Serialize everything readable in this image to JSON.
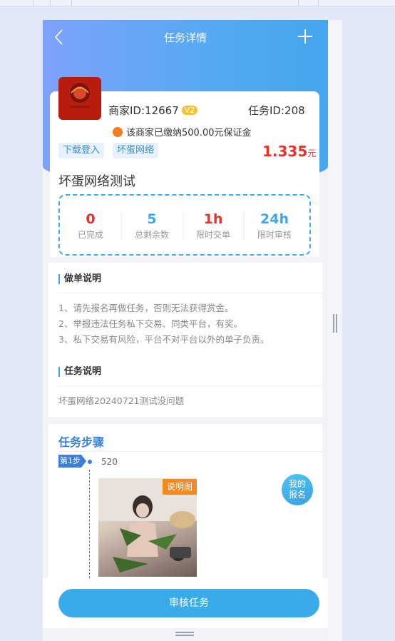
{
  "nav": {
    "title": "任务详情"
  },
  "merchant": {
    "id_label": "商家ID:12667",
    "level": "V2",
    "task_id_label": "任务ID:208",
    "deposit_text": "该商家已缴纳500.00元保证金"
  },
  "tags": [
    "下载登入",
    "坏蛋网络"
  ],
  "reward": {
    "amount": "1.335",
    "unit": "元"
  },
  "task_name": "坏蛋网络测试",
  "stats": [
    {
      "value": "0",
      "label": "已完成",
      "color": "#e6322c"
    },
    {
      "value": "5",
      "label": "总剩余数",
      "color": "#3ea6ea"
    },
    {
      "value": "1h",
      "label": "限时交单",
      "color": "#e6322c"
    },
    {
      "value": "24h",
      "label": "限时审核",
      "color": "#3ea6ea"
    }
  ],
  "instructions": {
    "title": "做单说明",
    "lines": [
      "1、请先报名再做任务，否则无法获得赏金。",
      "2、举报违法任务私下交易、同类平台，有奖。",
      "3、私下交易有风险，平台不对平台以外的单子负责。"
    ]
  },
  "task_desc": {
    "title": "任务说明",
    "text": "坏蛋网络20240721测试没问题"
  },
  "steps": {
    "title": "任务步骤",
    "step_label": "第1步",
    "step_text": "520",
    "image_label": "说明图"
  },
  "my_signup": {
    "line1": "我的",
    "line2": "报名"
  },
  "submit_label": "审核任务",
  "colors": {
    "accent": "#3aaae8",
    "price": "#e6322c"
  },
  "icons": {
    "back": "back-arrow-icon",
    "plus": "plus-icon",
    "deposit": "shield-icon"
  }
}
